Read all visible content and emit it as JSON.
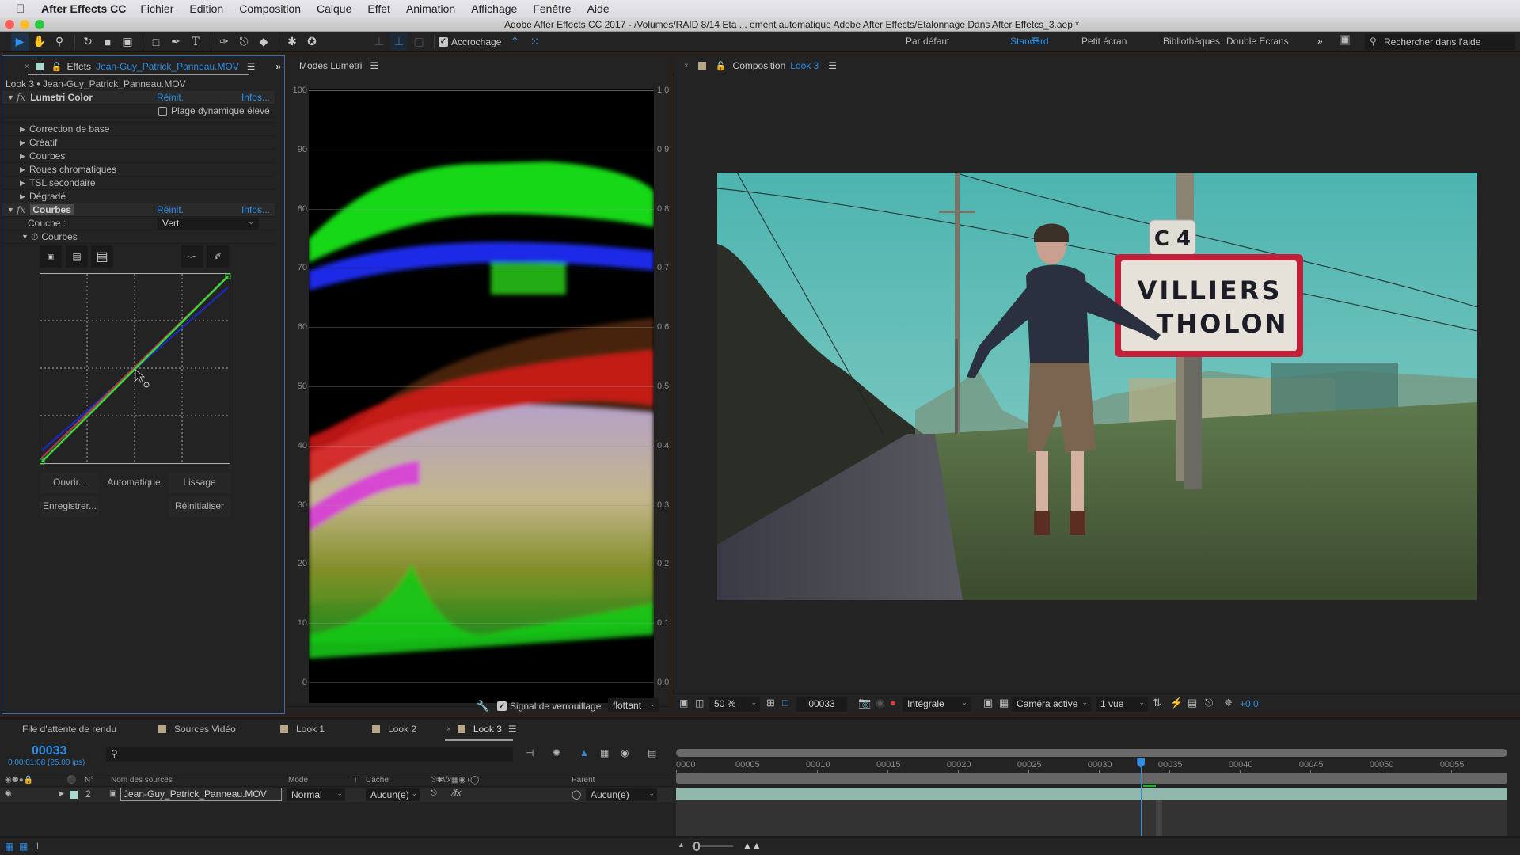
{
  "menubar": {
    "app_name": "After Effects CC",
    "items": [
      "Fichier",
      "Edition",
      "Composition",
      "Calque",
      "Effet",
      "Animation",
      "Affichage",
      "Fenêtre",
      "Aide"
    ]
  },
  "window": {
    "title": "Adobe After Effects CC 2017 - /Volumes/RAID 8/14 Eta ... ement automatique Adobe After Effects/Etalonnage Dans After Effetcs_3.aep *"
  },
  "toolbar": {
    "snapping_label": "Accrochage",
    "workspaces": [
      "Par défaut",
      "Standard",
      "Petit écran",
      "Bibliothèques",
      "Double Ecrans"
    ],
    "active_workspace": "Standard",
    "help_search_placeholder": "Rechercher dans l'aide"
  },
  "effects_panel": {
    "tab_label": "Effets",
    "tab_file": "Jean-Guy_Patrick_Panneau.MOV",
    "breadcrumb": "Look 3 • Jean-Guy_Patrick_Panneau.MOV",
    "lumetri": {
      "name": "Lumetri Color",
      "reset": "Réinit.",
      "info": "Infos...",
      "hdr_label": "Plage dynamique élevé",
      "sections": [
        "Correction de base",
        "Créatif",
        "Courbes",
        "Roues chromatiques",
        "TSL secondaire",
        "Dégradé"
      ]
    },
    "curves": {
      "name": "Courbes",
      "reset": "Réinit.",
      "info": "Infos...",
      "channel_label": "Couche :",
      "channel_value": "Vert",
      "sub_label": "Courbes",
      "buttons": {
        "open": "Ouvrir...",
        "auto": "Automatique",
        "smooth": "Lissage",
        "save": "Enregistrer...",
        "reset": "Réinitialiser"
      }
    }
  },
  "scopes_panel": {
    "title": "Modes Lumetri",
    "left_ticks": [
      "100",
      "90",
      "80",
      "70",
      "60",
      "50",
      "40",
      "30",
      "20",
      "10",
      "0"
    ],
    "right_ticks": [
      "1.0",
      "0.9",
      "0.8",
      "0.7",
      "0.6",
      "0.5",
      "0.4",
      "0.3",
      "0.2",
      "0.1",
      "0.0"
    ],
    "clamp_label": "Signal de verrouillage",
    "float_value": "flottant"
  },
  "composition_panel": {
    "label": "Composition",
    "name": "Look 3",
    "zoom": "50 %",
    "frame": "00033",
    "resolution": "Intégrale",
    "camera": "Caméra active",
    "views": "1 vue",
    "exposure": "+0,0",
    "sign_top": "C 4",
    "sign_line1": "VILLIERS",
    "sign_line2": "THOLON"
  },
  "timeline": {
    "tabs": [
      "File d'attente de rendu",
      "Sources Vidéo",
      "Look 1",
      "Look 2",
      "Look 3"
    ],
    "active_tab": "Look 3",
    "current_frame": "00033",
    "timecode": "0:00:01:08 (25.00 ips)",
    "columns": {
      "num": "N°",
      "source": "Nom des sources",
      "mode": "Mode",
      "t": "T",
      "cache": "Cache",
      "parent": "Parent"
    },
    "ruler": [
      "0000",
      "00005",
      "00010",
      "00015",
      "00020",
      "00025",
      "00030",
      "00035",
      "00040",
      "00045",
      "00050",
      "00055"
    ],
    "playhead_frame": 33,
    "total_frames": 59,
    "layer": {
      "number": "2",
      "name": "Jean-Guy_Patrick_Panneau.MOV",
      "mode": "Normal",
      "cache": "Aucun(e)",
      "parent": "Aucun(e)"
    }
  },
  "colors": {
    "accent": "#2e8ee6",
    "panel_bg": "#232323",
    "label_swatch": "#b7a788",
    "layer_bar": "#8fb7ac"
  }
}
